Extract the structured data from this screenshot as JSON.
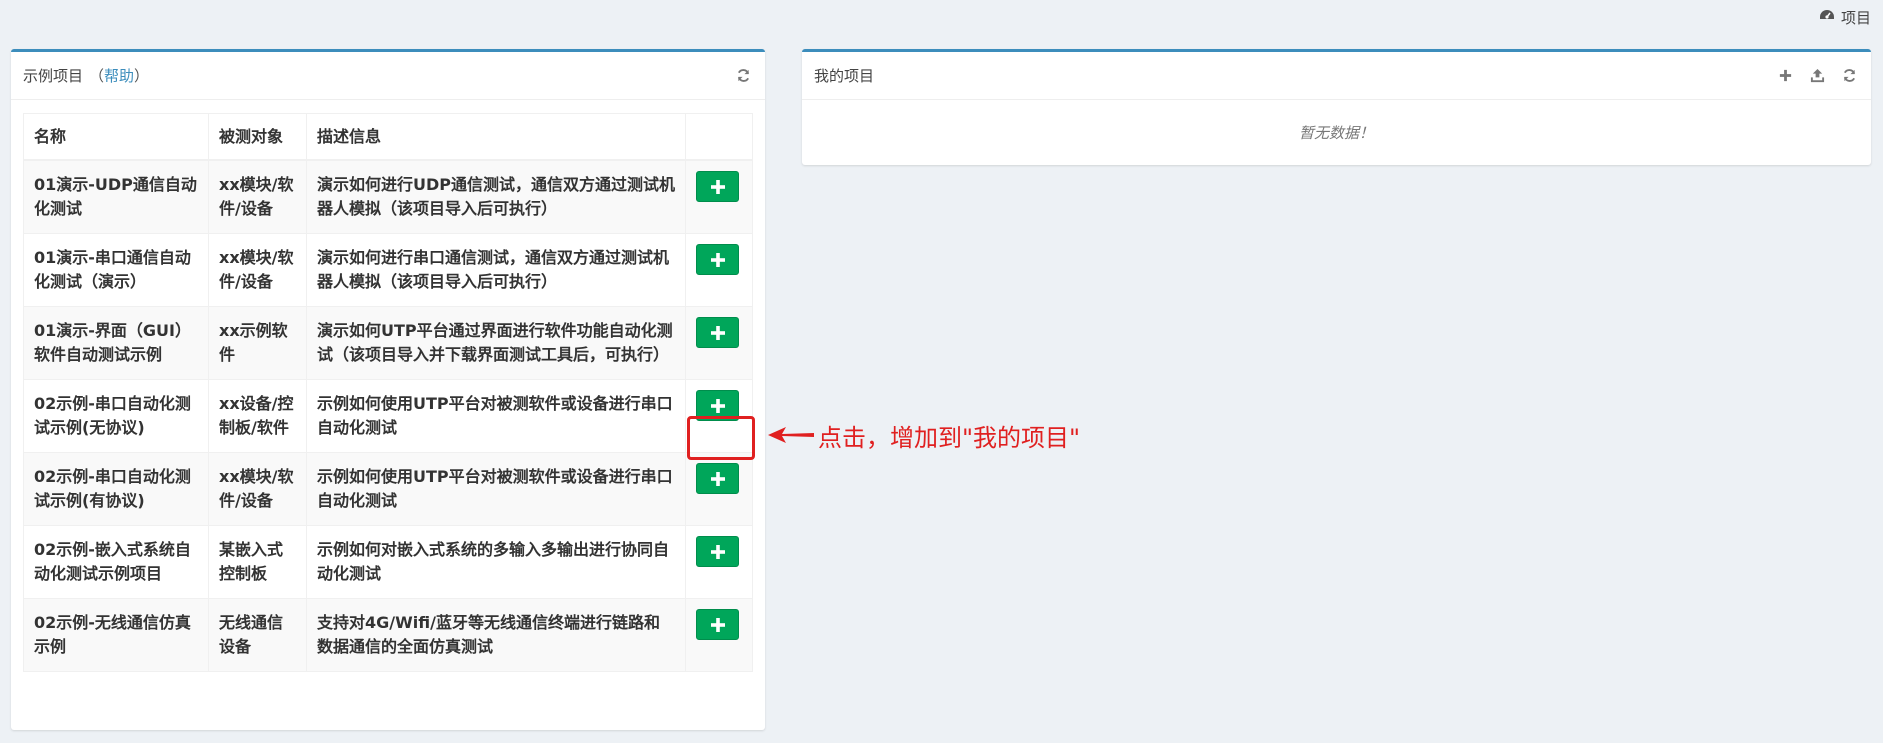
{
  "topbar": {
    "icon": "dashboard-icon",
    "label": "项目"
  },
  "left_panel": {
    "title": "示例项目",
    "paren_open": "（",
    "help_label": "帮助",
    "paren_close": "）",
    "columns": [
      "名称",
      "被测对象",
      "描述信息",
      ""
    ],
    "rows": [
      {
        "name": "01演示-UDP通信自动化测试",
        "target": "xx模块/软件/设备",
        "desc": "演示如何进行UDP通信测试，通信双方通过测试机器人模拟（该项目导入后可执行）"
      },
      {
        "name": "01演示-串口通信自动化测试（演示）",
        "target": "xx模块/软件/设备",
        "desc": "演示如何进行串口通信测试，通信双方通过测试机器人模拟（该项目导入后可执行）"
      },
      {
        "name": "01演示-界面（GUI）软件自动测试示例",
        "target": "xx示例软件",
        "desc": "演示如何UTP平台通过界面进行软件功能自动化测试（该项目导入并下载界面测试工具后，可执行）"
      },
      {
        "name": "02示例-串口自动化测试示例(无协议)",
        "target": "xx设备/控制板/软件",
        "desc": "示例如何使用UTP平台对被测软件或设备进行串口自动化测试"
      },
      {
        "name": "02示例-串口自动化测试示例(有协议)",
        "target": "xx模块/软件/设备",
        "desc": "示例如何使用UTP平台对被测软件或设备进行串口自动化测试"
      },
      {
        "name": "02示例-嵌入式系统自动化测试示例项目",
        "target": "某嵌入式控制板",
        "desc": "示例如何对嵌入式系统的多输入多输出进行协同自动化测试"
      },
      {
        "name": "02示例-无线通信仿真示例",
        "target": "无线通信设备",
        "desc": "支持对4G/Wifi/蓝牙等无线通信终端进行链路和数据通信的全面仿真测试"
      }
    ]
  },
  "right_panel": {
    "title": "我的项目",
    "empty_text": "暂无数据！"
  },
  "annotation": {
    "text": "点击，增加到\"我的项目\"",
    "color": "#e02020"
  },
  "colors": {
    "accent": "#3c8dbc",
    "add_button": "#00a65a"
  }
}
